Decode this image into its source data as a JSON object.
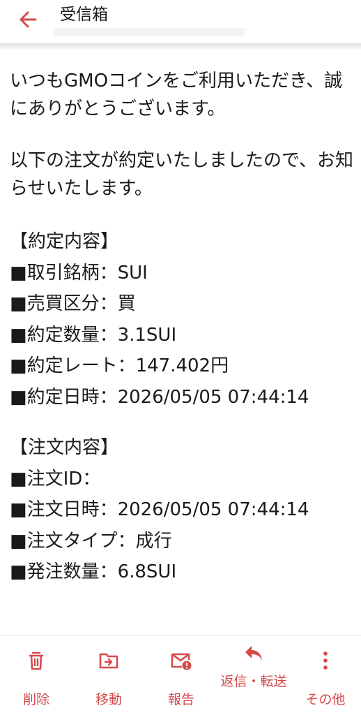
{
  "header": {
    "title": "受信箱"
  },
  "body": {
    "greeting": "いつもGMOコインをご利用いただき、誠にありがとうございます。",
    "notice": "以下の注文が約定いたしましたので、お知らせいたします。",
    "contract": {
      "title": "【約定内容】",
      "lines": [
        "■取引銘柄：SUI",
        "■売買区分：買",
        "■約定数量：3.1SUI",
        "■約定レート：147.402円",
        "■約定日時：2026/05/05 07:44:14"
      ]
    },
    "order": {
      "title": "【注文内容】",
      "lines": [
        "■注文ID：",
        "■注文日時：2026/05/05 07:44:14",
        "■注文タイプ：成行",
        "■発注数量：6.8SUI"
      ]
    }
  },
  "toolbar": {
    "delete_label": "削除",
    "move_label": "移動",
    "report_label": "報告",
    "reply_label": "返信・転送",
    "more_label": "その他"
  },
  "colors": {
    "accent": "#d64a4a"
  }
}
